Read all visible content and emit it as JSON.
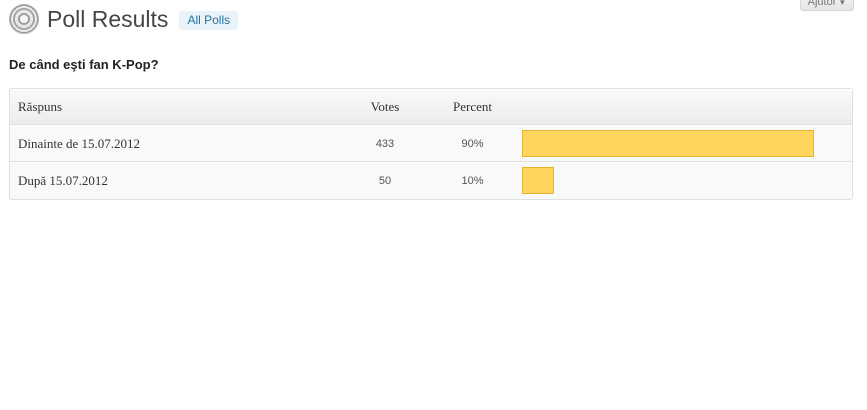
{
  "header": {
    "title": "Poll Results",
    "all_polls_label": "All Polls",
    "help_label": "Ajutor",
    "help_icon": "chevron-down-icon",
    "logo_icon": "poll-icon"
  },
  "question": "De când eşti fan K-Pop?",
  "table": {
    "columns": {
      "answer": "Răspuns",
      "votes": "Votes",
      "percent": "Percent"
    },
    "rows": [
      {
        "answer": "Dinainte de 15.07.2012",
        "votes": "433",
        "percent": "90%",
        "share": 0.9
      },
      {
        "answer": "După 15.07.2012",
        "votes": "50",
        "percent": "10%",
        "share": 0.1
      }
    ]
  },
  "colors": {
    "bar_fill": "#ffd55d",
    "bar_border": "#e6b531",
    "link": "#21759b"
  }
}
